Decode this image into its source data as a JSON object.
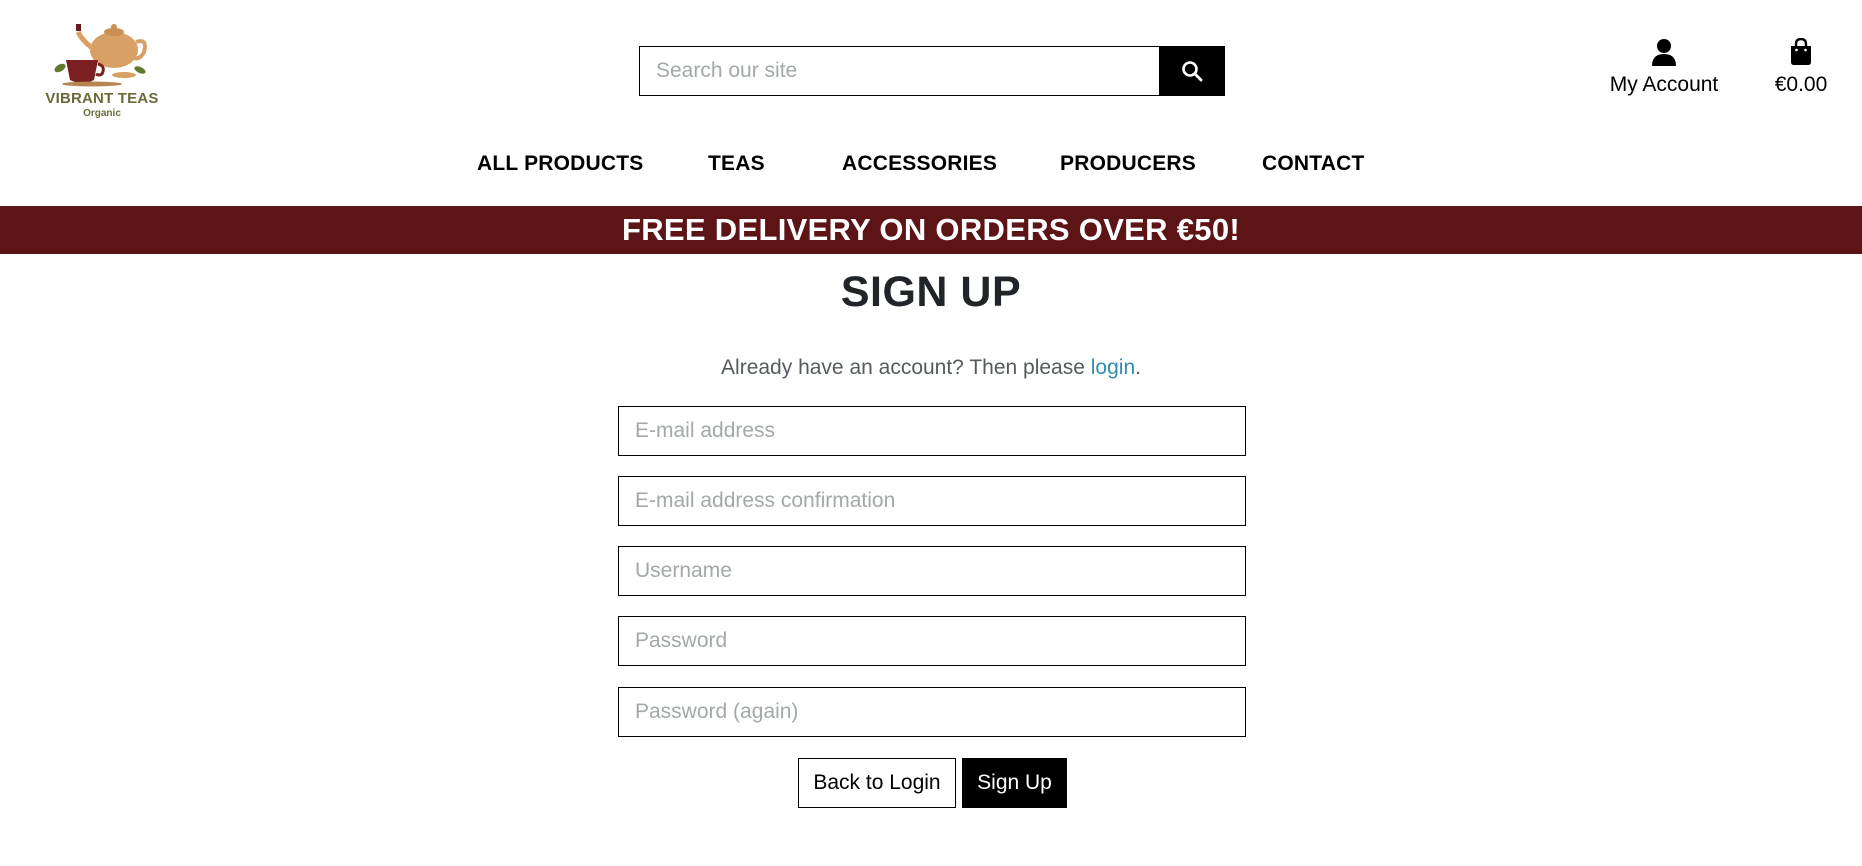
{
  "brand": {
    "name": "VIBRANT TEAS",
    "tagline": "Organic",
    "logo_icon": "teapot-and-cup-logo"
  },
  "search": {
    "placeholder": "Search our site",
    "icon": "search-icon"
  },
  "account": {
    "label": "My Account",
    "icon": "user-icon"
  },
  "cart": {
    "total": "€0.00",
    "icon": "shopping-bag-icon"
  },
  "nav": {
    "items": [
      {
        "label": "ALL PRODUCTS"
      },
      {
        "label": "TEAS"
      },
      {
        "label": "ACCESSORIES"
      },
      {
        "label": "PRODUCERS"
      },
      {
        "label": "CONTACT"
      }
    ]
  },
  "banner": {
    "text": "FREE DELIVERY ON ORDERS OVER €50!"
  },
  "signup": {
    "title": "SIGN UP",
    "prompt_prefix": "Already have an account? Then please ",
    "login_link": "login",
    "prompt_suffix": ".",
    "fields": [
      {
        "placeholder": "E-mail address",
        "value": ""
      },
      {
        "placeholder": "E-mail address confirmation",
        "value": ""
      },
      {
        "placeholder": "Username",
        "value": ""
      },
      {
        "placeholder": "Password",
        "value": ""
      },
      {
        "placeholder": "Password (again)",
        "value": ""
      }
    ],
    "back_button": "Back to Login",
    "submit_button": "Sign Up"
  },
  "colors": {
    "banner_bg": "#5c1417",
    "link": "#2f8fb0",
    "primary_button": "#000000",
    "logo_text": "#6b6b3a"
  }
}
